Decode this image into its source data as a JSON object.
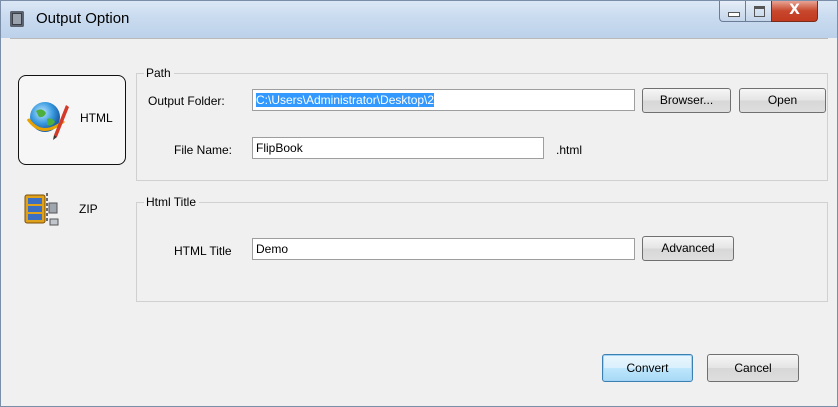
{
  "window": {
    "title": "Output Option",
    "close_glyph": "X"
  },
  "nav": {
    "items": [
      {
        "label": "HTML",
        "icon": "globe-pencil-icon",
        "selected": true
      },
      {
        "label": "ZIP",
        "icon": "zip-archive-icon",
        "selected": false
      }
    ]
  },
  "path_group": {
    "legend": "Path",
    "output_folder_label": "Output Folder:",
    "output_folder_value": "C:\\Users\\Administrator\\Desktop\\2",
    "browse_label": "Browser...",
    "open_label": "Open",
    "file_name_label": "File Name:",
    "file_name_value": "FlipBook",
    "extension": ".html"
  },
  "title_group": {
    "legend": "Html Title",
    "html_title_label": "HTML Title",
    "html_title_value": "Demo",
    "advanced_label": "Advanced"
  },
  "footer": {
    "convert_label": "Convert",
    "cancel_label": "Cancel"
  }
}
